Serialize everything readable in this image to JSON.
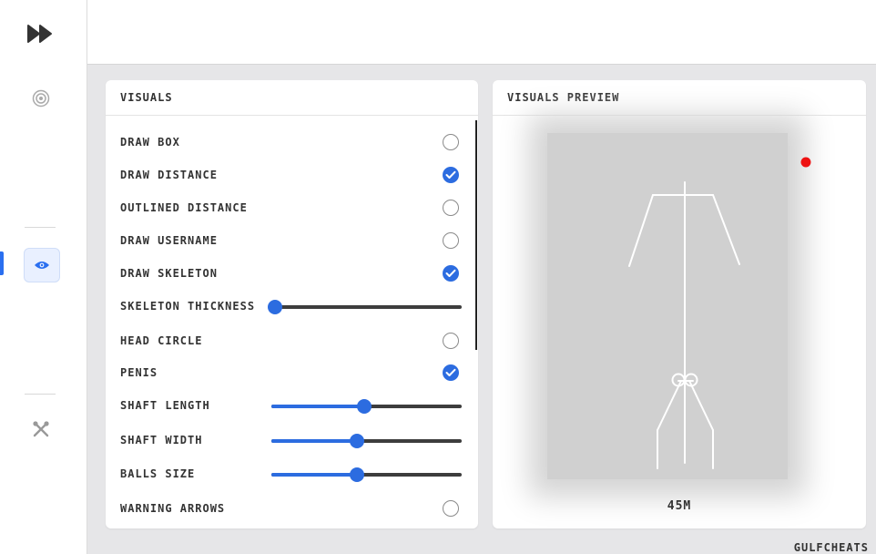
{
  "sidebar": {
    "icons": [
      "fast-forward-icon",
      "target-icon",
      "eye-icon",
      "tools-icon"
    ],
    "active": "eye-icon",
    "accent": "#2a6ff0"
  },
  "visuals": {
    "title": "VISUALS",
    "options": [
      {
        "label": "DRAW BOX",
        "type": "checkbox",
        "checked": false
      },
      {
        "label": "DRAW DISTANCE",
        "type": "checkbox",
        "checked": true
      },
      {
        "label": "OUTLINED DISTANCE",
        "type": "checkbox",
        "checked": false
      },
      {
        "label": "DRAW USERNAME",
        "type": "checkbox",
        "checked": false
      },
      {
        "label": "DRAW SKELETON",
        "type": "checkbox",
        "checked": true
      },
      {
        "label": "SKELETON THICKNESS",
        "type": "slider",
        "value": 0.0
      },
      {
        "label": "HEAD CIRCLE",
        "type": "checkbox",
        "checked": false
      },
      {
        "label": "PENIS",
        "type": "checkbox",
        "checked": true
      },
      {
        "label": "SHAFT LENGTH",
        "type": "slider",
        "value": 0.49
      },
      {
        "label": "SHAFT WIDTH",
        "type": "slider",
        "value": 0.45
      },
      {
        "label": "BALLS SIZE",
        "type": "slider",
        "value": 0.45
      },
      {
        "label": "WARNING ARROWS",
        "type": "checkbox",
        "checked": false
      }
    ],
    "check_color": "#2c6ce0"
  },
  "preview": {
    "title": "VISUALS PREVIEW",
    "distance": "45M",
    "dot_color": "#ee1111",
    "skeleton_color": "#ffffff"
  },
  "brand": "GULFCHEATS"
}
